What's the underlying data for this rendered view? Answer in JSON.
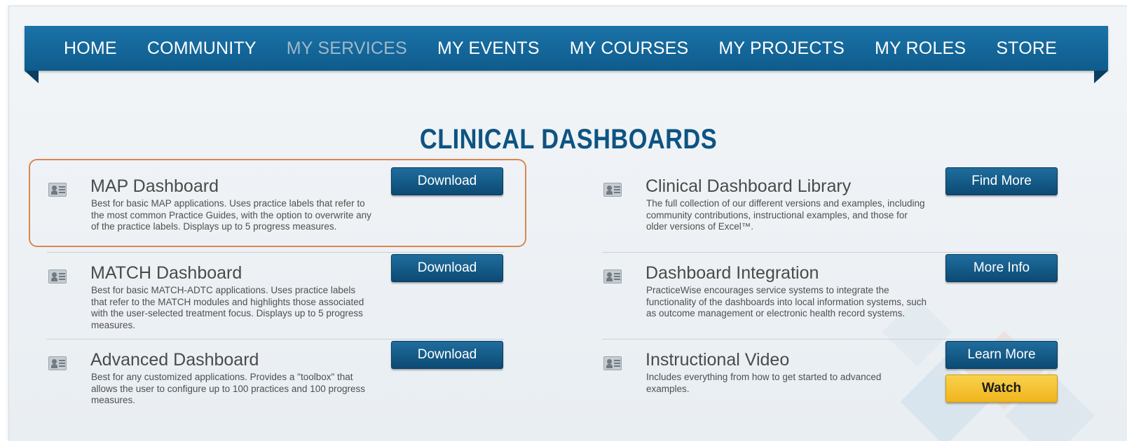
{
  "nav": {
    "items": [
      {
        "label": "HOME",
        "active": false
      },
      {
        "label": "COMMUNITY",
        "active": false
      },
      {
        "label": "MY SERVICES",
        "active": true
      },
      {
        "label": "MY EVENTS",
        "active": false
      },
      {
        "label": "MY COURSES",
        "active": false
      },
      {
        "label": "MY PROJECTS",
        "active": false
      },
      {
        "label": "MY ROLES",
        "active": false
      },
      {
        "label": "STORE",
        "active": false
      }
    ]
  },
  "page": {
    "title": "CLINICAL DASHBOARDS"
  },
  "left_items": [
    {
      "title": "MAP Dashboard",
      "desc": "Best for basic MAP applications. Uses practice labels that refer to the most common Practice Guides, with the option to overwrite any of the practice labels. Displays up to 5 progress measures.",
      "button": "Download"
    },
    {
      "title": "MATCH Dashboard",
      "desc": "Best for basic MATCH-ADTC applications. Uses practice labels that refer to the MATCH modules and highlights those associated with the user-selected treatment focus. Displays up to 5 progress measures.",
      "button": "Download"
    },
    {
      "title": "Advanced Dashboard",
      "desc": "Best for any customized applications. Provides a \"toolbox\" that allows the user to configure up to 100 practices and 100 progress measures.",
      "button": "Download"
    }
  ],
  "right_items": [
    {
      "title": "Clinical Dashboard Library",
      "desc": "The full collection of our different versions and examples, including community contributions, instructional examples, and those for older versions of Excel™.",
      "button": "Find More"
    },
    {
      "title": "Dashboard Integration",
      "desc": "PracticeWise encourages service systems to integrate the functionality of the dashboards into local information systems, such as outcome management or electronic health record systems.",
      "button": "More Info"
    },
    {
      "title": "Instructional Video",
      "desc": "Includes everything from how to get started to advanced examples.",
      "button": "Learn More",
      "button2": "Watch"
    }
  ],
  "icons": {
    "item_icon": "contact-card-icon"
  },
  "colors": {
    "nav_bg": "#156a9c",
    "title": "#0d5482",
    "button": "#0f5580",
    "watch_button": "#f4c23a",
    "highlight": "#d9874f"
  }
}
